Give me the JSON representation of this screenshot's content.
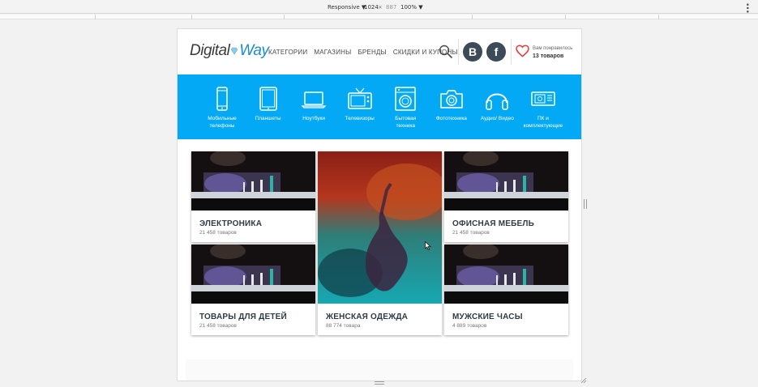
{
  "devtools": {
    "mode": "Responsive ▼",
    "width": "1024",
    "times": "×",
    "height": "887",
    "zoom": "100% ▼"
  },
  "header": {
    "logo_part1": "Digital",
    "logo_part2": "Way",
    "nav": [
      "КАТЕГОРИИ",
      "МАГАЗИНЫ",
      "БРЕНДЫ",
      "СКИДКИ И КУПОНЫ"
    ],
    "vk_label": "В",
    "fb_label": "f",
    "fav_line1": "Вам понравилось",
    "fav_line2": "13 товаров"
  },
  "categories": [
    {
      "icon": "mobile-phone-icon",
      "label": "Мобильные телефоны"
    },
    {
      "icon": "tablet-icon",
      "label": "Планшеты"
    },
    {
      "icon": "laptop-icon",
      "label": "Ноутбуки"
    },
    {
      "icon": "tv-icon",
      "label": "Телевизоры"
    },
    {
      "icon": "washing-machine-icon",
      "label": "Бытовая техника"
    },
    {
      "icon": "camera-icon",
      "label": "Фототехника"
    },
    {
      "icon": "headphones-icon",
      "label": "Аудио/ Видео"
    },
    {
      "icon": "pc-icon",
      "label": "ПК и комплектующие"
    }
  ],
  "tiles": [
    {
      "title": "ЭЛЕКТРОНИКА",
      "count": "21 458 товаров"
    },
    {
      "title": "ЖЕНСКАЯ ОДЕЖДА",
      "count": "88 774 товара"
    },
    {
      "title": "ОФИСНАЯ МЕБЕЛЬ",
      "count": "21 458 товаров"
    },
    {
      "title": "ТОВАРЫ ДЛЯ ДЕТЕЙ",
      "count": "21 458 товаров"
    },
    {
      "title": "МУЖСКИЕ ЧАСЫ",
      "count": "4 889 товаров"
    }
  ],
  "colors": {
    "accent": "#03a9f4",
    "logo_blue": "#1a8dc9",
    "social": "#3c4b57",
    "heart": "#e53935"
  }
}
